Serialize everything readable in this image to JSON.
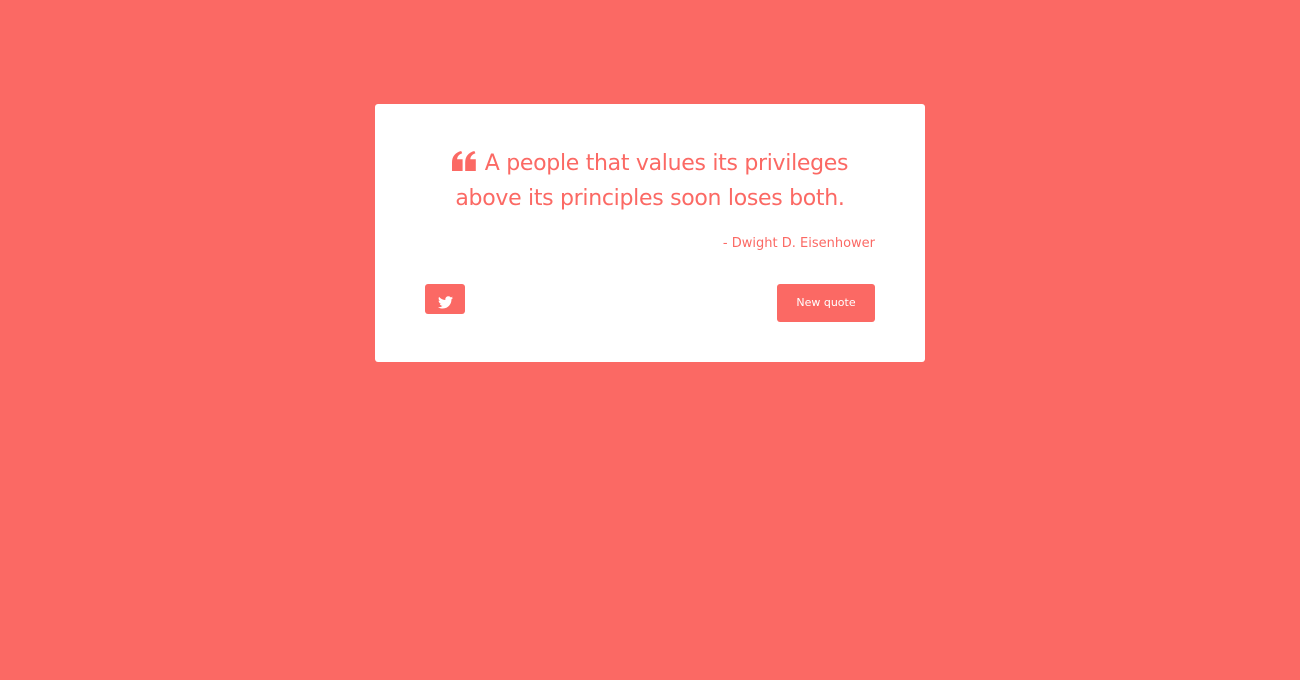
{
  "colors": {
    "background": "#fb6964",
    "card": "#ffffff",
    "accent": "#fb6964",
    "button_text": "#ffffff"
  },
  "quote": {
    "icon": "quote-left-icon",
    "text": "A people that values its privileges above its principles soon loses both.",
    "author": "- Dwight D. Eisenhower"
  },
  "actions": {
    "tweet_icon": "twitter-icon",
    "new_quote_label": "New quote"
  }
}
